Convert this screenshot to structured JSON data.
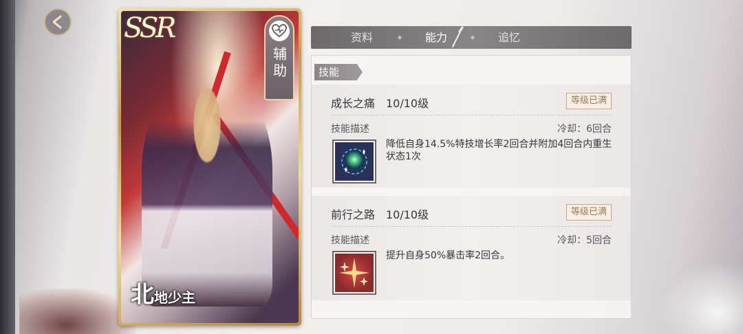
{
  "card": {
    "rarity": "SSR",
    "role": "辅助",
    "name_big": "北",
    "name_small": "地少主"
  },
  "tabs": [
    {
      "label": "资料",
      "active": false
    },
    {
      "label": "能力",
      "active": true
    },
    {
      "label": "追忆",
      "active": false
    }
  ],
  "panel": {
    "header": "技能",
    "skills": [
      {
        "name": "成长之痛",
        "level": "10/10级",
        "max_badge": "等级已满",
        "desc_label": "技能描述",
        "cooldown": "冷却：6回合",
        "description": "降低自身14.5%特技增长率2回合并附加4回合内重生状态1次",
        "icon": "green-orb-sparkle-icon",
        "icon_color": "#2b2f5a"
      },
      {
        "name": "前行之路",
        "level": "10/10级",
        "max_badge": "等级已满",
        "desc_label": "技能描述",
        "cooldown": "冷却：5回合",
        "description": "提升自身50%暴击率2回合。",
        "icon": "golden-star-burst-icon",
        "icon_color": "#8b2a2a"
      }
    ]
  }
}
